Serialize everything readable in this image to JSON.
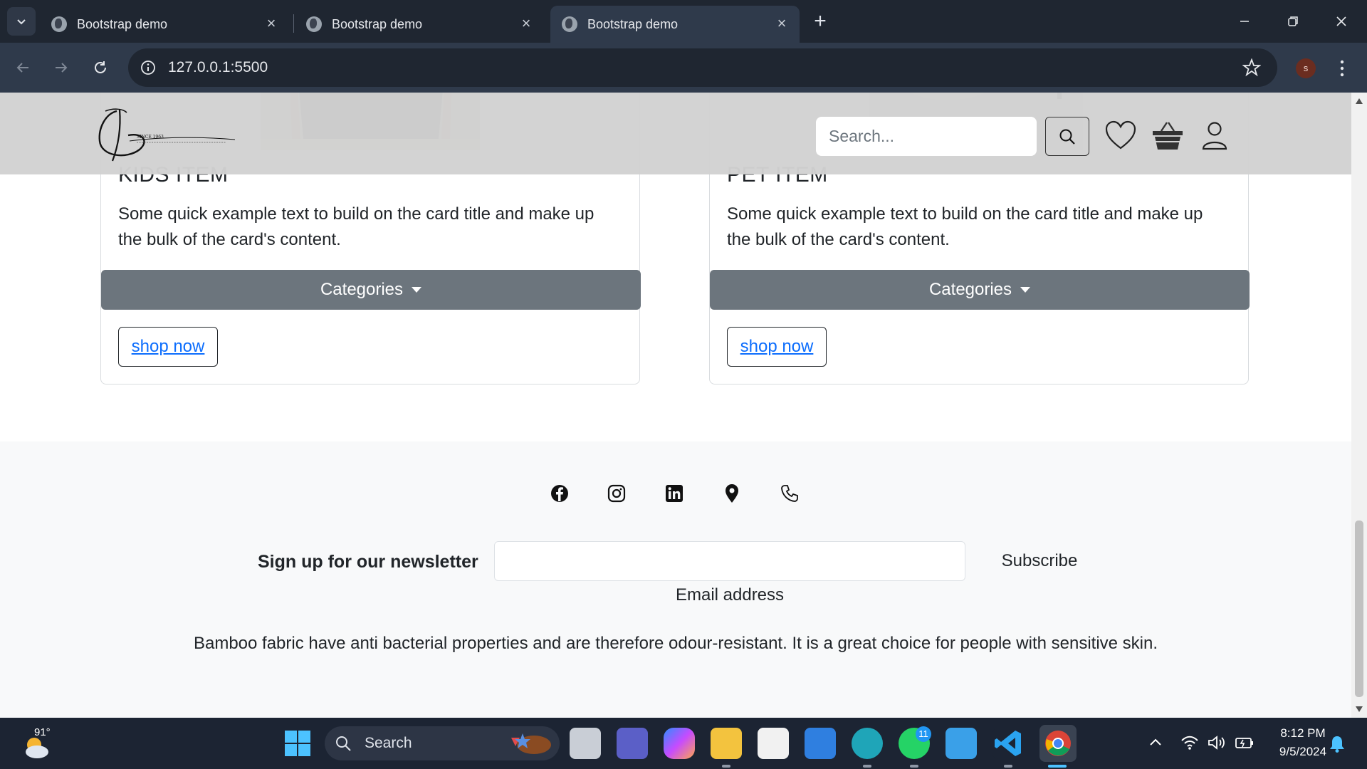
{
  "browser": {
    "tabs": [
      {
        "title": "Bootstrap demo"
      },
      {
        "title": "Bootstrap demo"
      },
      {
        "title": "Bootstrap demo"
      }
    ],
    "url": "127.0.0.1:5500",
    "profile_initial": "s"
  },
  "navbar": {
    "logo_text": "SINCE 1963",
    "search_placeholder": "Search..."
  },
  "cards": [
    {
      "title": "KIDS ITEM",
      "text": "Some quick example text to build on the card title and make up the bulk of the card's content.",
      "dropdown_label": "Categories",
      "shop_label": "shop now"
    },
    {
      "title": "PET ITEM",
      "text": "Some quick example text to build on the card title and make up the bulk of the card's content.",
      "dropdown_label": "Categories",
      "shop_label": "shop now"
    }
  ],
  "footer": {
    "social_icons": [
      "facebook-icon",
      "instagram-icon",
      "linkedin-icon",
      "location-pin-icon",
      "phone-icon"
    ],
    "newsletter_label": "Sign up for our newsletter",
    "email_label": "Email address",
    "subscribe_label": "Subscribe",
    "fabric_text": "Bamboo fabric have anti bacterial properties and are therefore odour-resistant. It is a great choice for people with sensitive skin."
  },
  "taskbar": {
    "weather_temp": "91°",
    "search_label": "Search",
    "whatsapp_badge": "11",
    "time": "8:12 PM",
    "date": "9/5/2024"
  },
  "colors": {
    "tab_strip": "#1f2631",
    "toolbar": "#2f3a4b",
    "dropdown_button": "#6c757d",
    "link": "#0d6efd",
    "footer_bg": "#f8f9fa"
  }
}
